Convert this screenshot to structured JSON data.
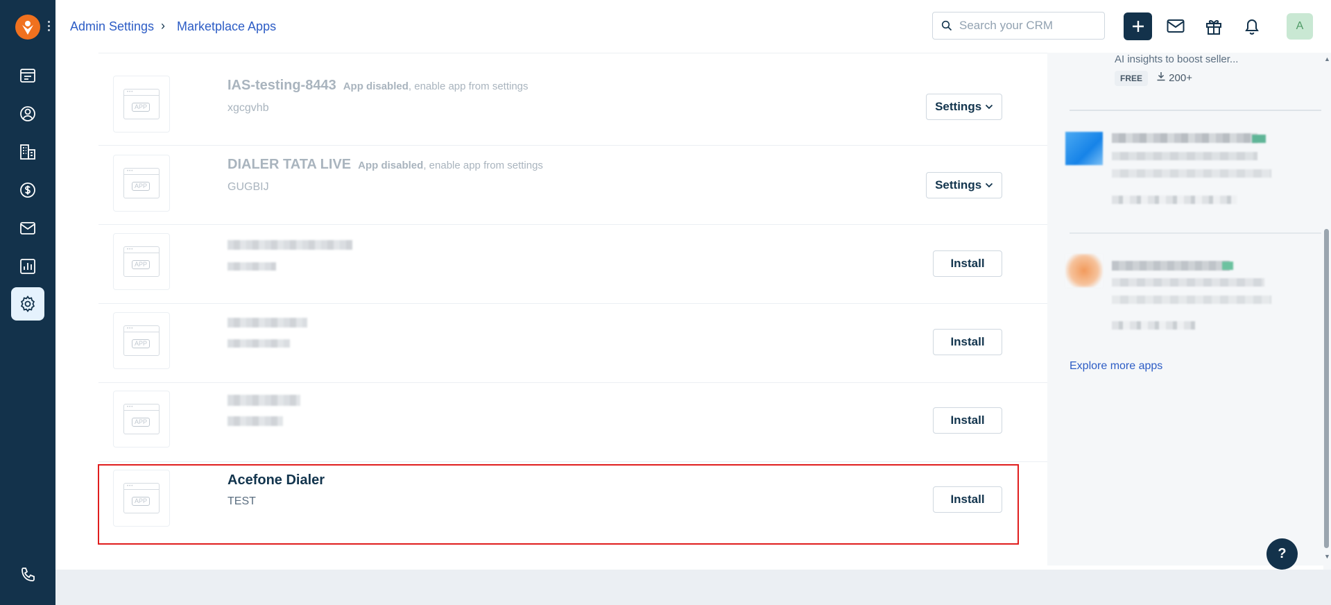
{
  "breadcrumb": {
    "parent": "Admin Settings",
    "separator": "›",
    "current": "Marketplace Apps"
  },
  "search": {
    "placeholder": "Search your CRM",
    "value": ""
  },
  "header": {
    "avatar_initial": "A"
  },
  "sidebar": {
    "items": [
      {
        "icon": "deals-icon"
      },
      {
        "icon": "contacts-icon"
      },
      {
        "icon": "accounts-icon"
      },
      {
        "icon": "dollar-icon"
      },
      {
        "icon": "mail-icon"
      },
      {
        "icon": "reports-icon"
      },
      {
        "icon": "settings-icon"
      }
    ],
    "bottom_icon": "phone-icon"
  },
  "apps": [
    {
      "name": "IAS-testing-8443",
      "disabled_note_bold": "App disabled",
      "disabled_note_rest": ", enable app from settings",
      "description": "xgcgvhb",
      "action": "Settings"
    },
    {
      "name": "DIALER TATA LIVE",
      "disabled_note_bold": "App disabled",
      "disabled_note_rest": ", enable app from settings",
      "description": "GUGBIJ",
      "action": "Settings"
    },
    {
      "action": "Install"
    },
    {
      "action": "Install"
    },
    {
      "action": "Install"
    },
    {
      "name": "Acefone Dialer",
      "description": "TEST",
      "action": "Install"
    }
  ],
  "right_panel": {
    "snippet": "AI insights to boost seller...",
    "price_badge": "FREE",
    "downloads": "200+",
    "explore_link": "Explore more apps"
  },
  "help_label": "?"
}
